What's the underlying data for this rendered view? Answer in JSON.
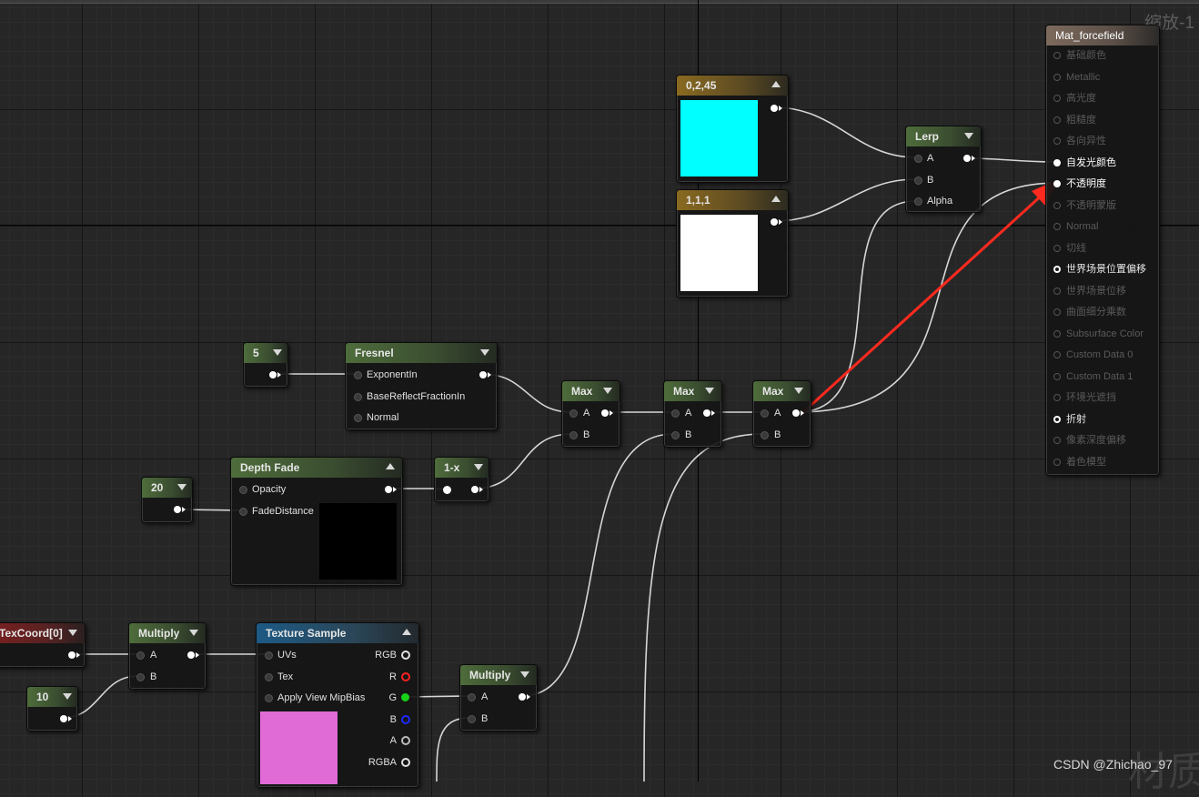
{
  "canvas": {
    "zoom_label": "缩放-1",
    "watermark": "CSDN @Zhichao_97",
    "watermark_bg": "材质"
  },
  "colors": {
    "wire": "#d6d6d6",
    "arrow": "#ff2a1f",
    "cyan": "#00ffff",
    "white": "#ffffff",
    "pink": "#e06ad6"
  },
  "result": {
    "title": "Mat_forcefield",
    "pins": [
      {
        "label": "基础颜色",
        "state": "dim"
      },
      {
        "label": "Metallic",
        "state": "dim"
      },
      {
        "label": "高光度",
        "state": "dim"
      },
      {
        "label": "粗糙度",
        "state": "dim"
      },
      {
        "label": "各向异性",
        "state": "dim"
      },
      {
        "label": "自发光颜色",
        "state": "on"
      },
      {
        "label": "不透明度",
        "state": "on"
      },
      {
        "label": "不透明蒙版",
        "state": "dim"
      },
      {
        "label": "Normal",
        "state": "dim"
      },
      {
        "label": "切线",
        "state": "dim"
      },
      {
        "label": "世界场景位置偏移",
        "state": "ring"
      },
      {
        "label": "世界场景位移",
        "state": "dim"
      },
      {
        "label": "曲面细分乘数",
        "state": "dim"
      },
      {
        "label": "Subsurface Color",
        "state": "dim"
      },
      {
        "label": "Custom Data 0",
        "state": "dim"
      },
      {
        "label": "Custom Data 1",
        "state": "dim"
      },
      {
        "label": "环境光遮挡",
        "state": "dim"
      },
      {
        "label": "折射",
        "state": "ring"
      },
      {
        "label": "像素深度偏移",
        "state": "dim"
      },
      {
        "label": "着色模型",
        "state": "dim"
      }
    ]
  },
  "nodes": {
    "const_cyan": {
      "title": "0,2,45"
    },
    "const_white": {
      "title": "1,1,1"
    },
    "lerp": {
      "title": "Lerp",
      "pin_a": "A",
      "pin_b": "B",
      "pin_alpha": "Alpha"
    },
    "const5": {
      "title": "5"
    },
    "fresnel": {
      "title": "Fresnel",
      "pin1": "ExponentIn",
      "pin2": "BaseReflectFractionIn",
      "pin3": "Normal"
    },
    "max1": {
      "title": "Max",
      "pin_a": "A",
      "pin_b": "B"
    },
    "max2": {
      "title": "Max",
      "pin_a": "A",
      "pin_b": "B"
    },
    "max3": {
      "title": "Max",
      "pin_a": "A",
      "pin_b": "B"
    },
    "const20": {
      "title": "20"
    },
    "depthfade": {
      "title": "Depth Fade",
      "pin1": "Opacity",
      "pin2": "FadeDistance"
    },
    "oneminus": {
      "title": "1-x"
    },
    "texcoord": {
      "title": "TexCoord[0]"
    },
    "multiply1": {
      "title": "Multiply",
      "pin_a": "A",
      "pin_b": "B"
    },
    "const10": {
      "title": "10"
    },
    "texsample": {
      "title": "Texture Sample",
      "in1": "UVs",
      "in2": "Tex",
      "in3": "Apply View MipBias",
      "out1": "RGB",
      "out2": "R",
      "out3": "G",
      "out4": "B",
      "out5": "A",
      "out6": "RGBA"
    },
    "multiply2": {
      "title": "Multiply",
      "pin_a": "A",
      "pin_b": "B"
    }
  }
}
